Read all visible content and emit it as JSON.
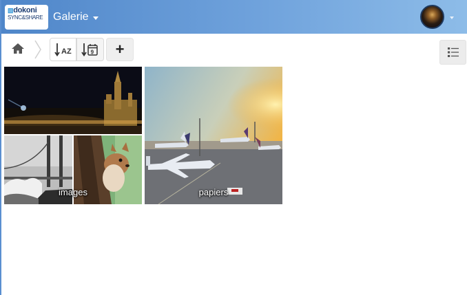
{
  "header": {
    "logo": {
      "line1": "dokoni",
      "line2": "SYNC&SHARE"
    },
    "app_title": "Galerie",
    "avatar": "user-avatar"
  },
  "toolbar": {
    "home_icon": "home-icon",
    "sort_name_icon": "sort-alpha-icon",
    "sort_date_icon": "sort-date-icon",
    "add_icon": "plus-icon",
    "add_label": "+",
    "view_icon": "list-view-icon"
  },
  "albums": [
    {
      "label": "images"
    },
    {
      "label": "papiers"
    }
  ],
  "colors": {
    "header_start": "#4f86c9",
    "header_end": "#8dbce8",
    "page_bg": "#ffffff"
  }
}
